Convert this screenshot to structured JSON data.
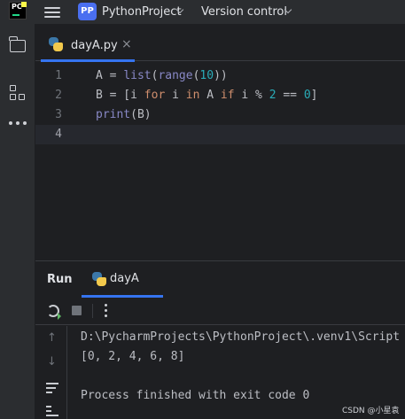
{
  "app": {
    "logo_text": "PC",
    "project_badge": "PP",
    "project_name": "PythonProject",
    "version_control": "Version control"
  },
  "editor_tab": {
    "label": "dayA.py",
    "close": "×"
  },
  "editor": {
    "line_numbers": [
      "1",
      "2",
      "3",
      "4"
    ],
    "lines": [
      [
        {
          "t": "A = ",
          "c": "fn"
        },
        {
          "t": "list",
          "c": "bi"
        },
        {
          "t": "(",
          "c": "fn"
        },
        {
          "t": "range",
          "c": "bi"
        },
        {
          "t": "(",
          "c": "fn"
        },
        {
          "t": "10",
          "c": "num"
        },
        {
          "t": "))",
          "c": "fn"
        }
      ],
      [
        {
          "t": "B = [i ",
          "c": "fn"
        },
        {
          "t": "for",
          "c": "kw"
        },
        {
          "t": " i ",
          "c": "fn"
        },
        {
          "t": "in",
          "c": "kw"
        },
        {
          "t": " A ",
          "c": "fn"
        },
        {
          "t": "if",
          "c": "kw"
        },
        {
          "t": " i % ",
          "c": "fn"
        },
        {
          "t": "2",
          "c": "num"
        },
        {
          "t": " == ",
          "c": "fn"
        },
        {
          "t": "0",
          "c": "num"
        },
        {
          "t": "]",
          "c": "fn"
        }
      ],
      [
        {
          "t": "print",
          "c": "bi"
        },
        {
          "t": "(B)",
          "c": "fn"
        }
      ],
      []
    ]
  },
  "run": {
    "title": "Run",
    "tab_label": "dayA",
    "output": [
      "D:\\PycharmProjects\\PythonProject\\.venv1\\Script",
      "[0, 2, 4, 6, 8]",
      "",
      "Process finished with exit code 0"
    ]
  },
  "watermark": "CSDN @小星袁",
  "colors": {
    "accent": "#3574f0",
    "keyword": "#cf8e6d",
    "builtin": "#8888c6",
    "number": "#2aacb8",
    "text": "#bcbec4"
  }
}
